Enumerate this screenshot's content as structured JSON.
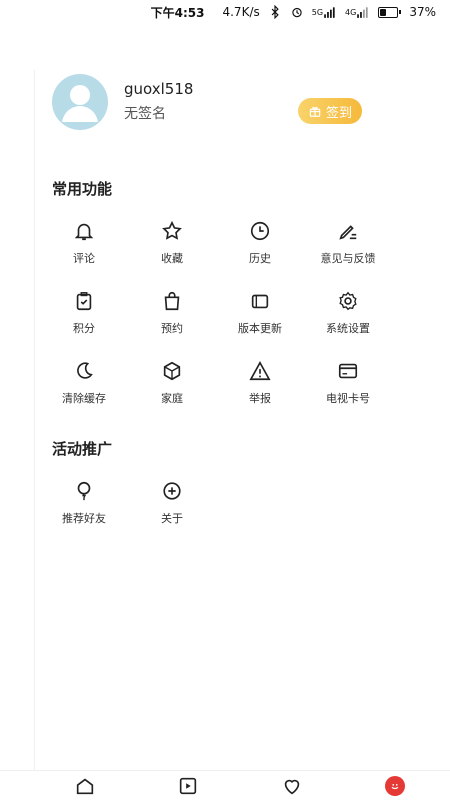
{
  "status_bar": {
    "time": "下午4:53",
    "net_speed": "4.7K/s",
    "battery_text": "37%",
    "battery_level": 0.37,
    "signal_1": "5G",
    "signal_2": "4G"
  },
  "profile": {
    "username": "guoxl518",
    "signature": "无签名",
    "signin_label": "签到"
  },
  "common_section": {
    "title": "常用功能",
    "items": [
      {
        "label": "评论",
        "icon": "bell-icon"
      },
      {
        "label": "收藏",
        "icon": "star-icon"
      },
      {
        "label": "历史",
        "icon": "clock-icon"
      },
      {
        "label": "意见与反馈",
        "icon": "pen-icon"
      },
      {
        "label": "积分",
        "icon": "clipboard-check-icon"
      },
      {
        "label": "预约",
        "icon": "bag-icon"
      },
      {
        "label": "版本更新",
        "icon": "wallet-icon"
      },
      {
        "label": "系统设置",
        "icon": "gear-icon"
      },
      {
        "label": "清除缓存",
        "icon": "moon-icon"
      },
      {
        "label": "家庭",
        "icon": "cube-icon"
      },
      {
        "label": "举报",
        "icon": "warning-icon"
      },
      {
        "label": "电视卡号",
        "icon": "card-icon"
      }
    ]
  },
  "promo_section": {
    "title": "活动推广",
    "items": [
      {
        "label": "推荐好友",
        "icon": "balloon-icon"
      },
      {
        "label": "关于",
        "icon": "plus-circle-icon"
      }
    ]
  },
  "bottom_nav": [
    {
      "icon": "home-icon"
    },
    {
      "icon": "play-icon"
    },
    {
      "icon": "heart-icon"
    },
    {
      "icon": "profile-smile-icon"
    }
  ],
  "colors": {
    "accent": "#e53935",
    "signin_start": "#f8d36a",
    "signin_end": "#f6b93b",
    "avatar_bg": "#b7dce8"
  }
}
